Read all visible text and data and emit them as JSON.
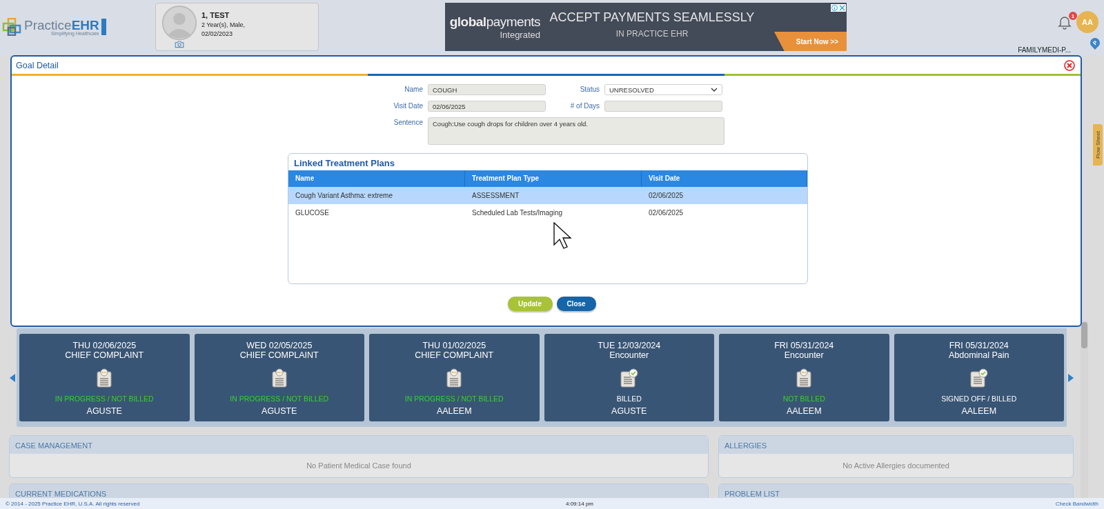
{
  "header": {
    "logo": {
      "word_a": "Practice",
      "word_b": "EHR",
      "tagline": "Simplifying Healthcare"
    },
    "patient": {
      "name": "1, TEST",
      "age_sex": "2 Year(s), Male,",
      "dob": "02/02/2023"
    },
    "ad": {
      "brand_bold": "global",
      "brand_light": "payments",
      "brand_sub": "Integrated",
      "headline": "ACCEPT PAYMENTS SEAMLESSLY",
      "subline": "IN PRACTICE EHR",
      "cta": "Start Now >>"
    },
    "notifications": "1",
    "avatar": "AA",
    "practice": "FAMILYMEDI-P...",
    "pin": "P"
  },
  "goal_detail": {
    "title": "Goal Detail",
    "fields": [
      {
        "label": "Name",
        "value": "COUGH",
        "kind": "text"
      },
      {
        "label": "Status",
        "value": "UNRESOLVED",
        "kind": "select"
      },
      {
        "label": "Visit Date",
        "value": "02/06/2025",
        "kind": "text"
      },
      {
        "label": "# of Days",
        "kind": "text"
      },
      {
        "label": "Sentence",
        "value": "Cough:Use cough drops for children over 4 years old.",
        "kind": "area"
      }
    ],
    "linked_plans": {
      "title": "Linked Treatment Plans",
      "columns": [
        "Name",
        "Treatment Plan Type",
        "Visit Date"
      ],
      "rows": [
        {
          "cells": [
            "Cough Variant Asthma: extreme",
            "ASSESSMENT",
            "02/06/2025"
          ],
          "selected": true
        },
        {
          "cells": [
            "GLUCOSE",
            "Scheduled Lab Tests/Imaging",
            "02/06/2025"
          ],
          "selected": false
        }
      ]
    },
    "buttons": [
      {
        "label": "Update",
        "kind": "primary"
      },
      {
        "label": "Close",
        "kind": "secondary"
      }
    ]
  },
  "visits": [
    {
      "date": "THU 02/06/2025",
      "title": "CHIEF COMPLAINT",
      "kind": "pending",
      "status": "IN PROGRESS / NOT BILLED",
      "color": "#35d135",
      "provider": "AGUSTE"
    },
    {
      "date": "WED 02/05/2025",
      "title": "CHIEF COMPLAINT",
      "kind": "pending",
      "status": "IN PROGRESS / NOT BILLED",
      "color": "#35d135",
      "provider": "AGUSTE"
    },
    {
      "date": "THU 01/02/2025",
      "title": "CHIEF COMPLAINT",
      "kind": "pending",
      "status": "IN PROGRESS / NOT BILLED",
      "color": "#35d135",
      "provider": "AALEEM"
    },
    {
      "date": "TUE 12/03/2024",
      "title": "Encounter",
      "kind": "signed",
      "status": "BILLED",
      "color": "#ffffff",
      "provider": "AGUSTE"
    },
    {
      "date": "FRI 05/31/2024",
      "title": "Encounter",
      "kind": "pending",
      "status": "NOT BILLED",
      "color": "#35d135",
      "provider": "AALEEM"
    },
    {
      "date": "FRI 05/31/2024",
      "title": "Abdominal Pain",
      "kind": "signed",
      "status": "SIGNED OFF / BILLED",
      "color": "#ffffff",
      "provider": "AALEEM"
    }
  ],
  "sections": [
    {
      "title": "CASE MANAGEMENT",
      "message": "No Patient Medical Case found"
    },
    {
      "title": "ALLERGIES",
      "message": "No Active Allergies documented"
    },
    {
      "title": "CURRENT MEDICATIONS"
    },
    {
      "title": "PROBLEM LIST"
    }
  ],
  "flow_sheet": "Flow Sheet",
  "footer": {
    "copyright": "© 2014 - 2025 Practice EHR, U.S.A. All rights reserved",
    "time": "4:09:14 pm",
    "link": "Check Bandwidth"
  }
}
